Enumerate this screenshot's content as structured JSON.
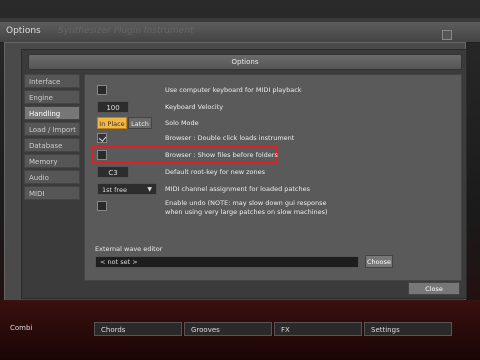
{
  "window": {
    "title": "Options",
    "ghost_title": "Synthesizer Plugin Instrument"
  },
  "panel": {
    "header": "Options"
  },
  "sidebar": {
    "items": [
      {
        "label": "Interface"
      },
      {
        "label": "Engine"
      },
      {
        "label": "Handling",
        "active": true
      },
      {
        "label": "Load / Import"
      },
      {
        "label": "Database"
      },
      {
        "label": "Memory"
      },
      {
        "label": "Audio"
      },
      {
        "label": "MIDI"
      }
    ]
  },
  "settings": {
    "midi_keyboard": "Use computer keyboard for MIDI playback",
    "velocity_value": "100",
    "velocity_label": "Keyboard Velocity",
    "solo_inplace": "In Place",
    "solo_latch": "Latch",
    "solo_label": "Solo Mode",
    "browser_dblclick": "Browser : Double click loads instrument",
    "browser_show_files": "Browser : Show files before folders",
    "rootkey_value": "C3",
    "rootkey_label": "Default root-key for new zones",
    "midi_channel_value": "1st free",
    "midi_channel_label": "MIDI channel assignment for loaded patches",
    "undo_label_line1": "Enable undo (NOTE: may slow down gui response",
    "undo_label_line2": "when using very large patches on slow machines)"
  },
  "editor": {
    "label": "External wave editor",
    "value": "< not set >",
    "choose": "Choose"
  },
  "close_button": "Close",
  "bottom": {
    "combi": "Combi",
    "tabs": [
      "Chords",
      "Grooves",
      "FX",
      "Settings"
    ]
  },
  "colors": {
    "accent": "#f0b840",
    "highlight": "#e02020"
  }
}
